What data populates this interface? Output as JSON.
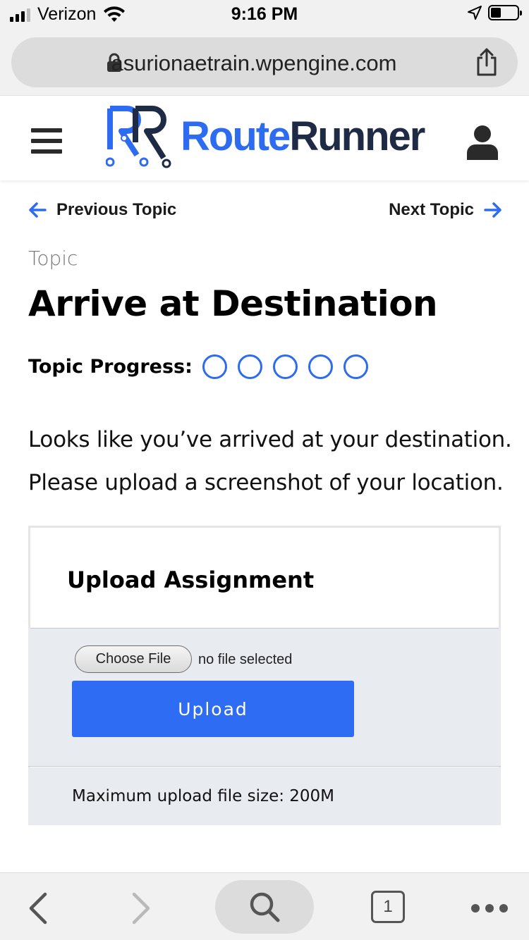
{
  "status_bar": {
    "carrier": "Verizon",
    "time": "9:16 PM"
  },
  "browser": {
    "url": "asurionaetrain.wpengine.com",
    "open_tabs": "1"
  },
  "site": {
    "logo_part1": "Route",
    "logo_part2": "Runner"
  },
  "topic_nav": {
    "previous": "Previous Topic",
    "next": "Next Topic"
  },
  "topic": {
    "label": "Topic",
    "title": "Arrive at Destination",
    "progress_label": "Topic Progress:",
    "progress_steps_total": 5,
    "progress_steps_done": 0,
    "body_line1": "Looks like you’ve arrived at your destination.",
    "body_line2": "Please upload a screenshot of your location."
  },
  "upload": {
    "title": "Upload Assignment",
    "choose_file": "Choose File",
    "file_status": "no file selected",
    "button": "Upload",
    "max_size": "Maximum upload file size: 200M"
  },
  "colors": {
    "brand_blue": "#2d6cf0",
    "brand_navy": "#1f2a44",
    "upload_button": "#2f6cf4"
  }
}
